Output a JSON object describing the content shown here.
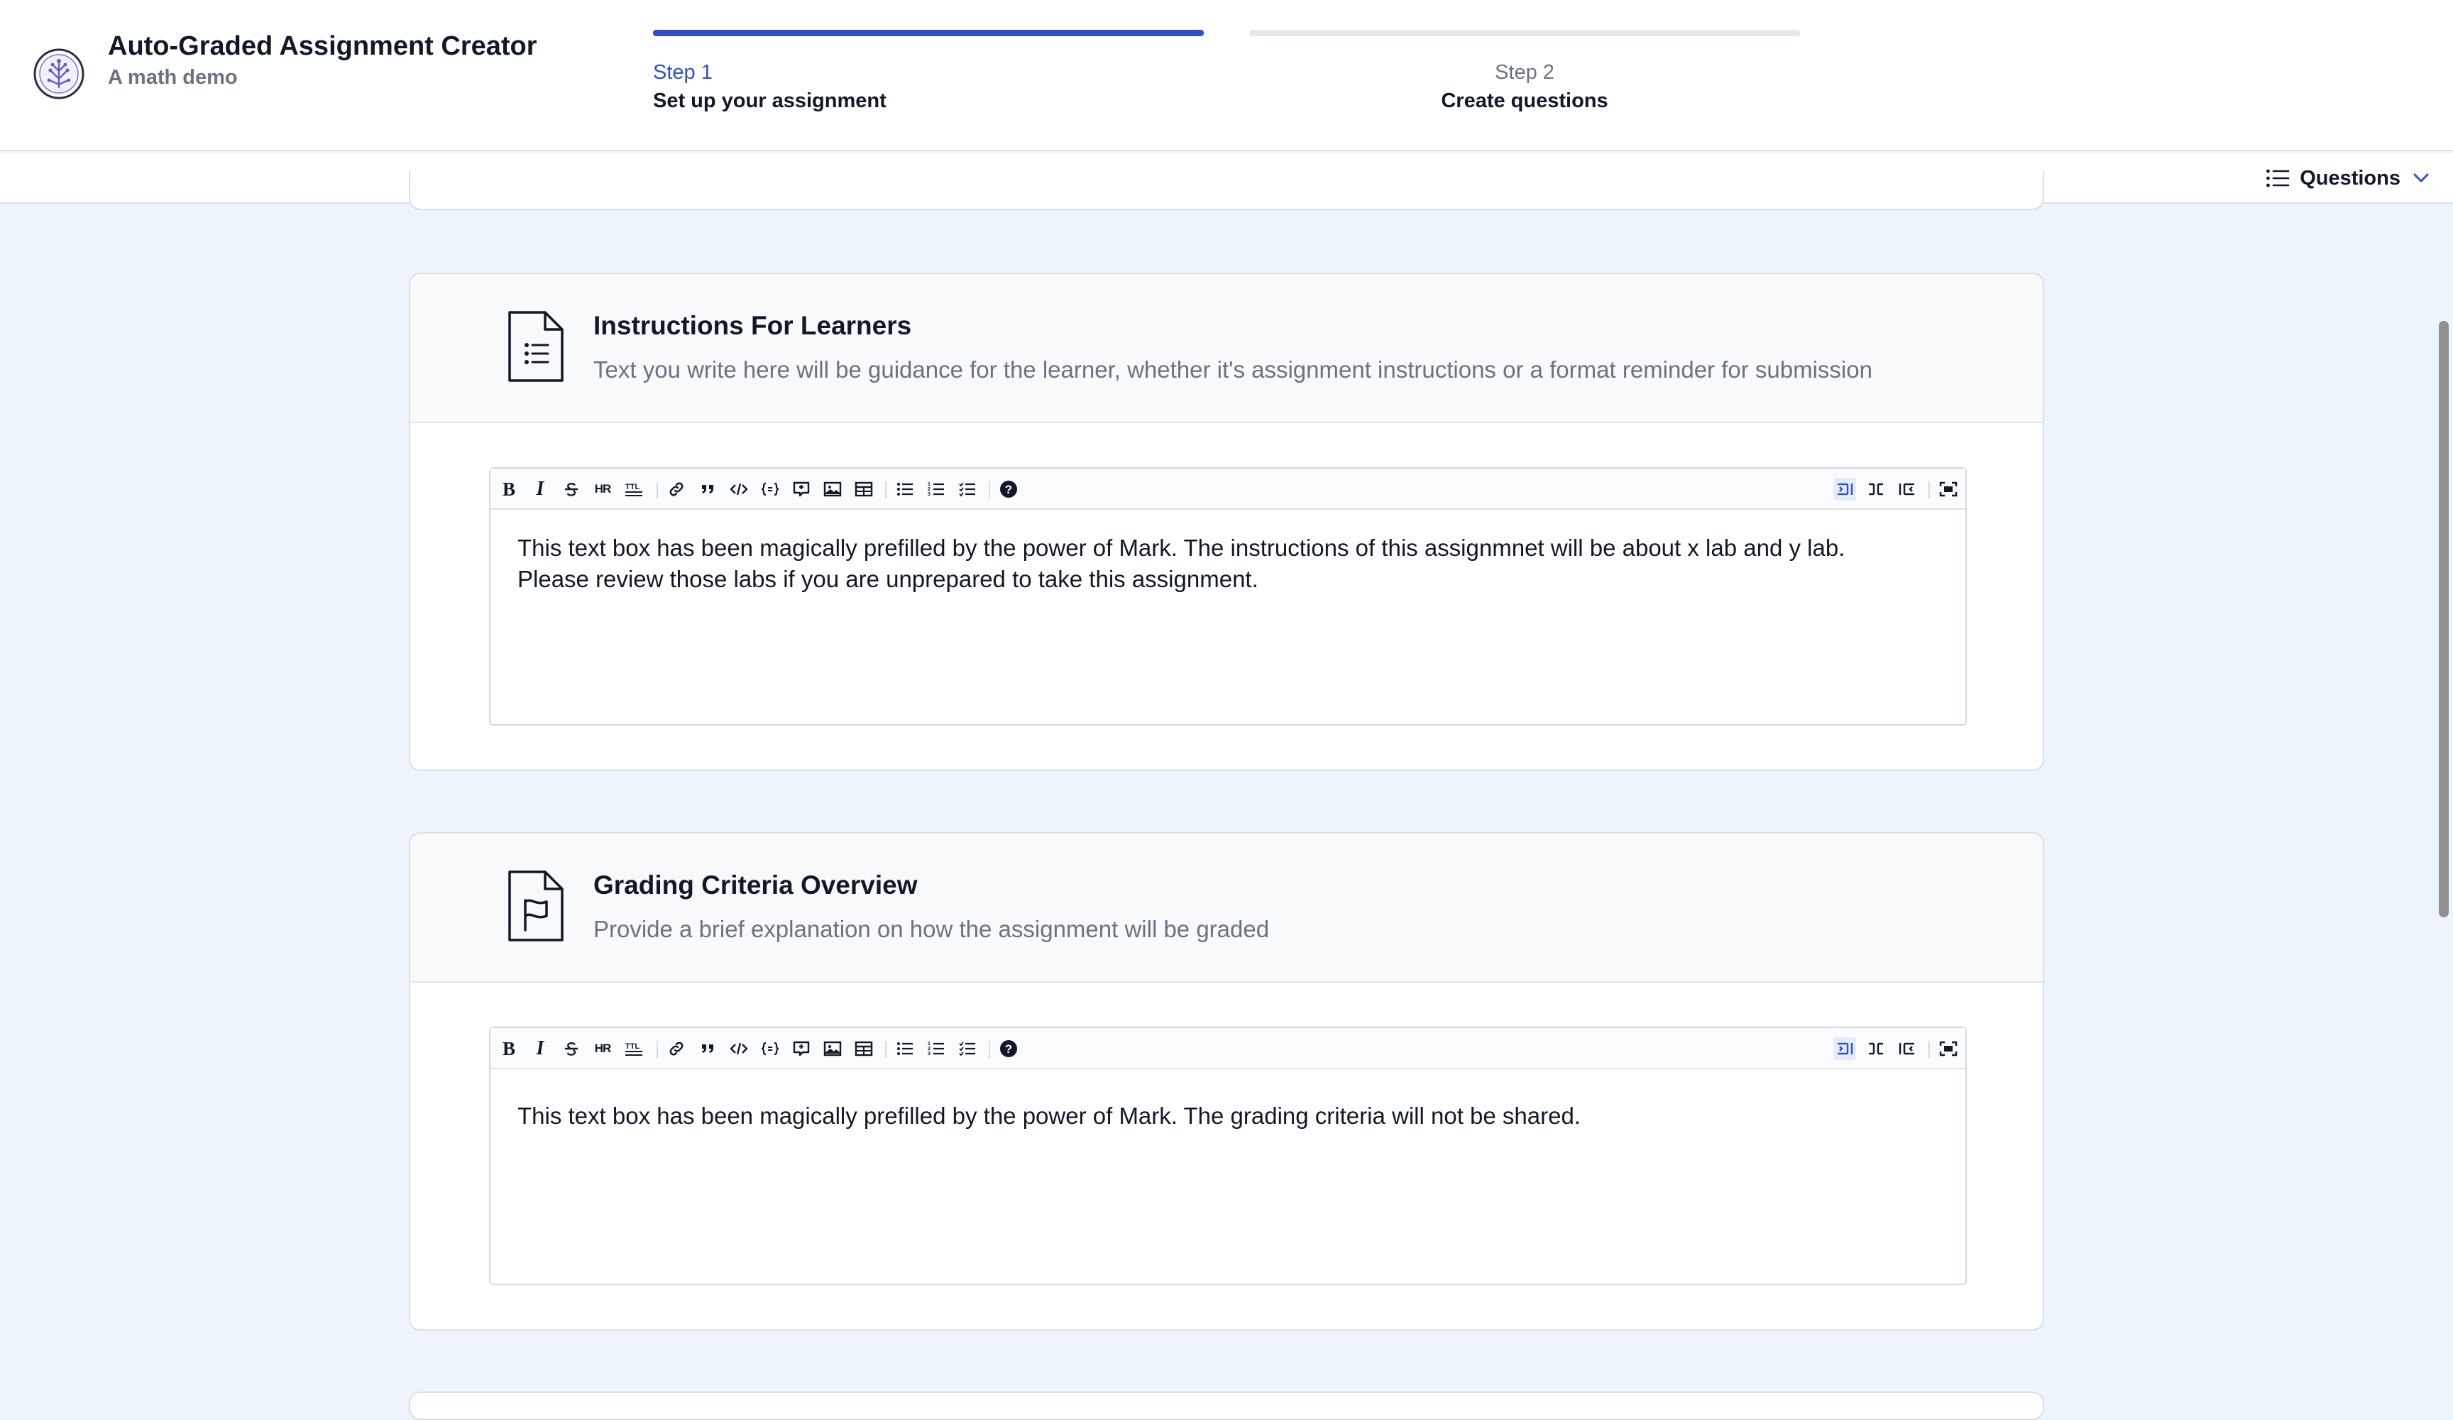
{
  "header": {
    "title": "Auto-Graded Assignment Creator",
    "subtitle": "A math demo",
    "logo_icon": "tree-logo-icon"
  },
  "steps": [
    {
      "number": "Step 1",
      "label": "Set up your assignment",
      "active": true
    },
    {
      "number": "Step 2",
      "label": "Create questions",
      "active": false
    }
  ],
  "subbar": {
    "questions_label": "Questions",
    "icon": "list-icon",
    "chevron": "chevron-down-icon"
  },
  "cards": [
    {
      "title": "Instructions For Learners",
      "description": "Text you write here will be guidance for the learner, whether it's assignment instructions or a format reminder for submission",
      "icon": "document-list-icon",
      "content_line1": "This text box has been magically prefilled by the power of Mark. The instructions of this assignmnet will be about x lab and y lab.",
      "content_line2": "Please review those labs if you are unprepared to take this assignment."
    },
    {
      "title": "Grading Criteria Overview",
      "description": "Provide a brief explanation on how the assignment will be graded",
      "icon": "document-flag-icon",
      "content_line1": "This text box has been magically prefilled by the power of Mark. The grading criteria will not be shared.",
      "content_line2": ""
    }
  ],
  "toolbar_tools": [
    "bold",
    "italic",
    "strikethrough",
    "horizontal-rule",
    "title",
    "link",
    "quote",
    "code",
    "code-block",
    "comment",
    "image",
    "table",
    "unordered-list",
    "ordered-list",
    "check-list",
    "help",
    "edit-mode",
    "live-mode",
    "preview-mode",
    "fullscreen"
  ],
  "colors": {
    "accent": "#2f4fd0",
    "page_background": "#eef4fb",
    "card_header": "#f7f9fb"
  }
}
